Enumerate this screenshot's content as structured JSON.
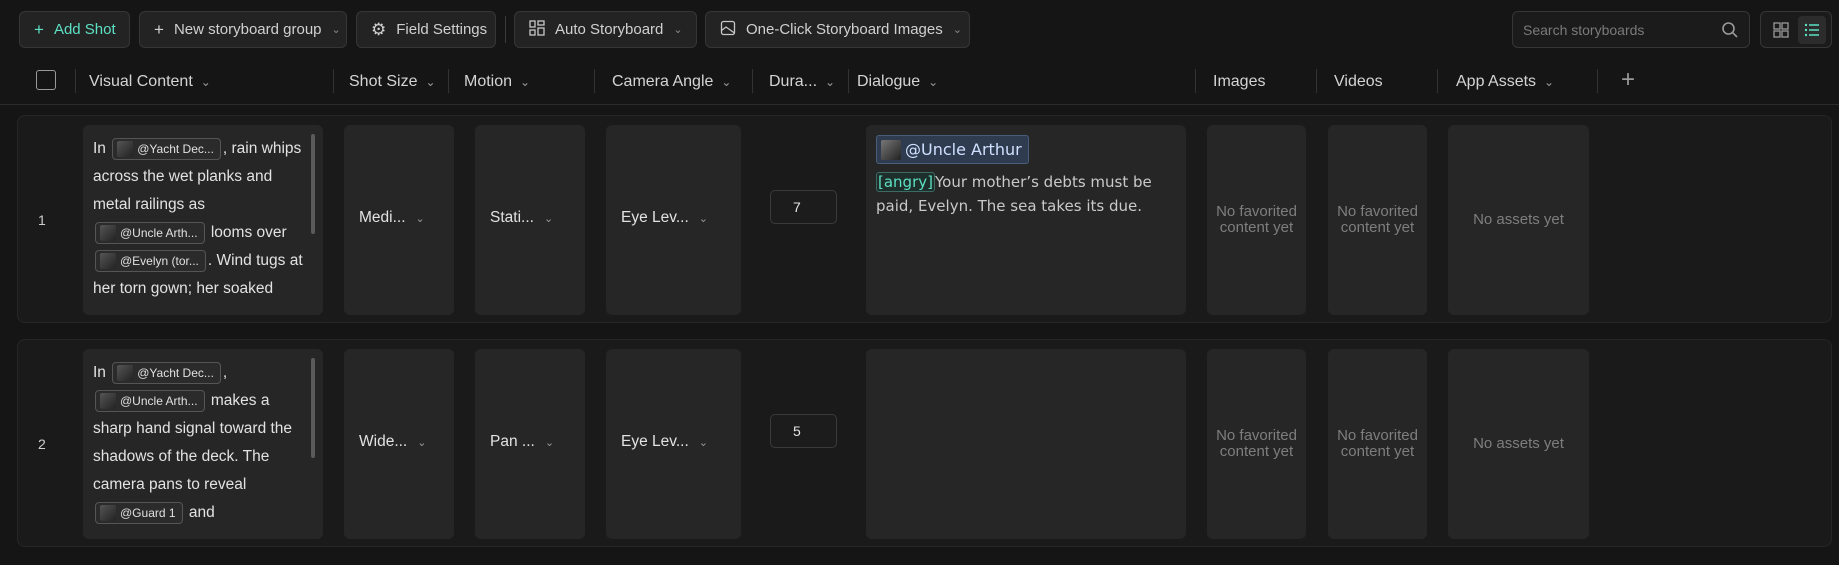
{
  "toolbar": {
    "add_shot": "Add Shot",
    "new_group": "New storyboard group",
    "field_settings": "Field Settings",
    "auto_storyboard": "Auto Storyboard",
    "one_click_images": "One-Click Storyboard Images"
  },
  "search": {
    "placeholder": "Search storyboards"
  },
  "header": {
    "visual_content": "Visual Content",
    "shot_size": "Shot Size",
    "motion": "Motion",
    "camera_angle": "Camera Angle",
    "duration": "Dura...",
    "dialogue": "Dialogue",
    "images": "Images",
    "videos": "Videos",
    "app_assets": "App Assets"
  },
  "rows": [
    {
      "number": "1",
      "visual": {
        "t1": "In",
        "chip1": "@Yacht Dec...",
        "t2": ", rain whips across the wet planks and metal railings as",
        "chip2": "@Uncle Arth...",
        "t3": "looms over",
        "chip3": "@Evelyn (tor...",
        "t4": ". Wind tugs at her torn gown; her soaked"
      },
      "shot_size": "Medi...",
      "motion": "Stati...",
      "camera_angle": "Eye Lev...",
      "duration": "7",
      "dialogue": {
        "mention": "@Uncle Arthur",
        "emotion": "[angry]",
        "text": "Your mother’s debts must be paid, Evelyn. The sea takes its due."
      },
      "images": "No favorited content yet",
      "videos": "No favorited content yet",
      "assets": "No assets yet"
    },
    {
      "number": "2",
      "visual": {
        "t1": "In",
        "chip1": "@Yacht Dec...",
        "t2": ",",
        "chip2": "@Uncle Arth...",
        "t3": "makes a sharp hand signal toward the shadows of the deck. The camera pans to reveal",
        "chip3": "@Guard 1",
        "t4": "and"
      },
      "shot_size": "Wide...",
      "motion": "Pan ...",
      "camera_angle": "Eye Lev...",
      "duration": "5",
      "images": "No favorited content yet",
      "videos": "No favorited content yet",
      "assets": "No assets yet"
    }
  ],
  "icons": {
    "add": "plus-icon",
    "group": "plus-icon",
    "settings": "gear-icon",
    "auto": "grid-icon",
    "oneclick": "image-icon",
    "search": "search-icon",
    "grid_view": "grid-view-icon",
    "list_view": "list-view-icon"
  },
  "colors": {
    "accent": "#5de0c3",
    "background": "#151515",
    "mention": "#2f3b4e"
  }
}
